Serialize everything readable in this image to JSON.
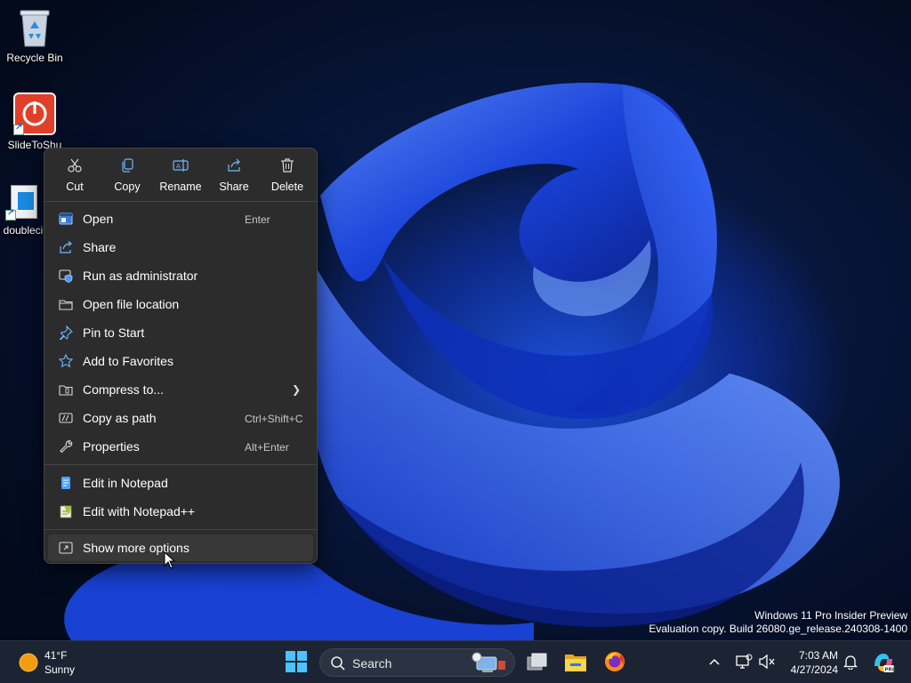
{
  "desktop": {
    "icons": [
      {
        "label": "Recycle Bin",
        "icon": "recycle-bin-icon"
      },
      {
        "label": "SlideToShu",
        "icon": "power-shortcut-icon"
      },
      {
        "label": "doubleci",
        "icon": "file-shortcut-icon"
      }
    ],
    "watermark": {
      "line1": "Windows 11 Pro Insider Preview",
      "line2": "Evaluation copy. Build 26080.ge_release.240308-1400"
    }
  },
  "context_menu": {
    "quick_actions": [
      {
        "label": "Cut",
        "icon": "cut-icon"
      },
      {
        "label": "Copy",
        "icon": "copy-icon"
      },
      {
        "label": "Rename",
        "icon": "rename-icon"
      },
      {
        "label": "Share",
        "icon": "share-icon"
      },
      {
        "label": "Delete",
        "icon": "delete-icon"
      }
    ],
    "items": [
      {
        "label": "Open",
        "shortcut": "Enter",
        "icon": "open-icon"
      },
      {
        "label": "Share",
        "shortcut": "",
        "icon": "share-icon"
      },
      {
        "label": "Run as administrator",
        "shortcut": "",
        "icon": "shield-icon"
      },
      {
        "label": "Open file location",
        "shortcut": "",
        "icon": "folder-icon"
      },
      {
        "label": "Pin to Start",
        "shortcut": "",
        "icon": "pin-icon"
      },
      {
        "label": "Add to Favorites",
        "shortcut": "",
        "icon": "star-icon"
      },
      {
        "label": "Compress to...",
        "shortcut": "",
        "icon": "zip-icon",
        "submenu": true
      },
      {
        "label": "Copy as path",
        "shortcut": "Ctrl+Shift+C",
        "icon": "path-icon"
      },
      {
        "label": "Properties",
        "shortcut": "Alt+Enter",
        "icon": "wrench-icon"
      },
      {
        "label": "Edit in Notepad",
        "shortcut": "",
        "icon": "notepad-icon"
      },
      {
        "label": "Edit with Notepad++",
        "shortcut": "",
        "icon": "notepadpp-icon"
      },
      {
        "label": "Show more options",
        "shortcut": "",
        "icon": "more-options-icon",
        "hovered": true
      }
    ]
  },
  "taskbar": {
    "weather": {
      "temp": "41°F",
      "condition": "Sunny"
    },
    "search": {
      "label": "Search"
    },
    "clock": {
      "time": "7:03 AM",
      "date": "4/27/2024"
    }
  },
  "colors": {
    "menu_bg": "#2c2c2c",
    "accent": "#4cc2ff",
    "taskbar_bg": "#1c2433"
  }
}
